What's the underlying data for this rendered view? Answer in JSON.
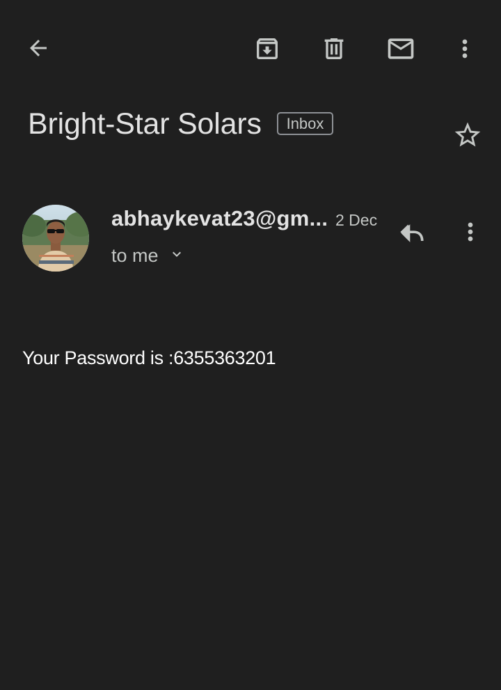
{
  "toolbar": {
    "back_icon": "arrow-left-icon",
    "archive_icon": "archive-icon",
    "delete_icon": "trash-icon",
    "mark_unread_icon": "mail-icon",
    "more_icon": "more-vertical-icon"
  },
  "email": {
    "subject": "Bright-Star Solars",
    "label": "Inbox",
    "star_icon": "star-outline-icon",
    "sender": "abhaykevat23@gm...",
    "date": "2 Dec",
    "recipient_line": "to me",
    "body": "Your Password is :6355363201"
  },
  "colors": {
    "background": "#1f1f1f",
    "text_primary": "#e3e3e3",
    "text_secondary": "#c4c7c5",
    "body_text": "#ffffff",
    "chip_border": "#8e9196"
  }
}
